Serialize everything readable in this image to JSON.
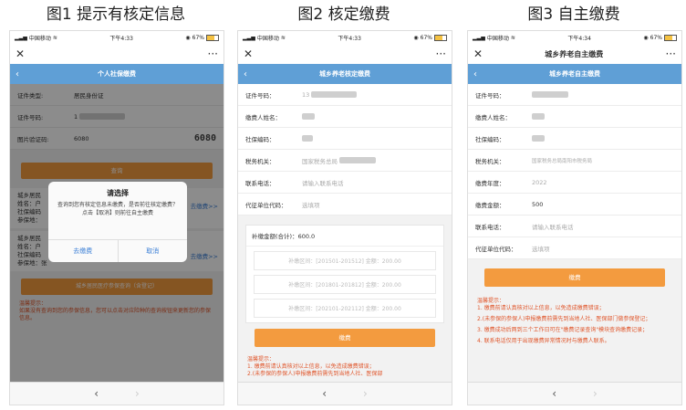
{
  "captions": [
    "图1 提示有核定信息",
    "图2 核定缴费",
    "图3 自主缴费"
  ],
  "status": {
    "carrier": "中国移动",
    "battery": "67%",
    "time1": "下午4:33",
    "time2": "下午4:33",
    "time3": "下午4:34"
  },
  "topbar": {
    "close": "✕",
    "more": "···"
  },
  "nav": {
    "back": "‹",
    "forward": "›"
  },
  "screen1": {
    "title": "个人社保缴费",
    "fields": [
      {
        "label": "证件类型:",
        "value": "居民身份证"
      },
      {
        "label": "证件号码:",
        "value": "1"
      },
      {
        "label": "图片验证码:",
        "value": "6080"
      }
    ],
    "captcha": "6080",
    "query_button": "查询",
    "list": [
      {
        "a": "城乡居民",
        "b": "姓名：户",
        "c": "社保编码",
        "d": "参保地："
      },
      {
        "a": "城乡居民",
        "b": "姓名：户",
        "c": "社保编码",
        "d": "参保地：张"
      }
    ],
    "pay_link": "去缴费>>",
    "medical_button": "城乡居民医疗参保查询（含登记）",
    "tip_title": "温馨提示：",
    "tip_text": "如果没有查询到您的参保信息，您可以点击对应险种的查询按钮来更新您的参保信息。",
    "dialog": {
      "title": "请选择",
      "message": "查询到您有核定信息未缴费，是否前往核定缴费？点击【取消】则前往自主缴费",
      "ok": "去缴费",
      "cancel": "取消"
    }
  },
  "screen2": {
    "title": "城乡养老核定缴费",
    "fields": [
      {
        "label": "证件号码：",
        "value": "13"
      },
      {
        "label": "缴费人姓名：",
        "value": ""
      },
      {
        "label": "社保编码：",
        "value": ""
      },
      {
        "label": "税务机关：",
        "value": "国家税务总局"
      },
      {
        "label": "联系电话：",
        "placeholder": "请输入联系电话"
      },
      {
        "label": "代征单位代码：",
        "placeholder": "选填项"
      }
    ],
    "summary": "补缴金额(合计)：600.0",
    "lines": [
      "补缴区间：[201501-201512] 金额：200.00",
      "补缴区间：[201801-201812] 金额：200.00",
      "补缴区间：[202101-202112] 金额：200.00"
    ],
    "pay_button": "缴费",
    "tip_title": "温馨提示：",
    "tip_lines": [
      "1. 缴费前请认真核对以上信息，以免造成缴费错误；",
      "2.(未参保的参保人)申报缴费前需先到当地人社、医保部"
    ]
  },
  "screen3": {
    "title": "城乡养老自主缴费",
    "fields": [
      {
        "label": "证件号码：",
        "value": ""
      },
      {
        "label": "缴费人姓名：",
        "value": ""
      },
      {
        "label": "社保编码：",
        "value": ""
      },
      {
        "label": "税务机关：",
        "value": "国家税务总局南阳市税务局"
      },
      {
        "label": "缴费年度：",
        "value": "2022"
      },
      {
        "label": "缴费金额：",
        "value": "500"
      },
      {
        "label": "联系电话：",
        "placeholder": "请输入联系电话"
      },
      {
        "label": "代征单位代码：",
        "placeholder": "选填项"
      }
    ],
    "pay_button": "缴费",
    "tip_title": "温馨提示：",
    "tip_lines": [
      "1. 缴费前请认真核对以上信息，以免造成缴费错误；",
      "2.(未参保的参保人)申报缴费前需先到当地人社、医保部门做参保登记；",
      "3. 缴费成功后两到三个工作日可在\"缴费记录查询\"模块查询缴费记录；",
      "4. 联系电话仅用于出现缴费异常情况时与缴费人联系。"
    ]
  }
}
